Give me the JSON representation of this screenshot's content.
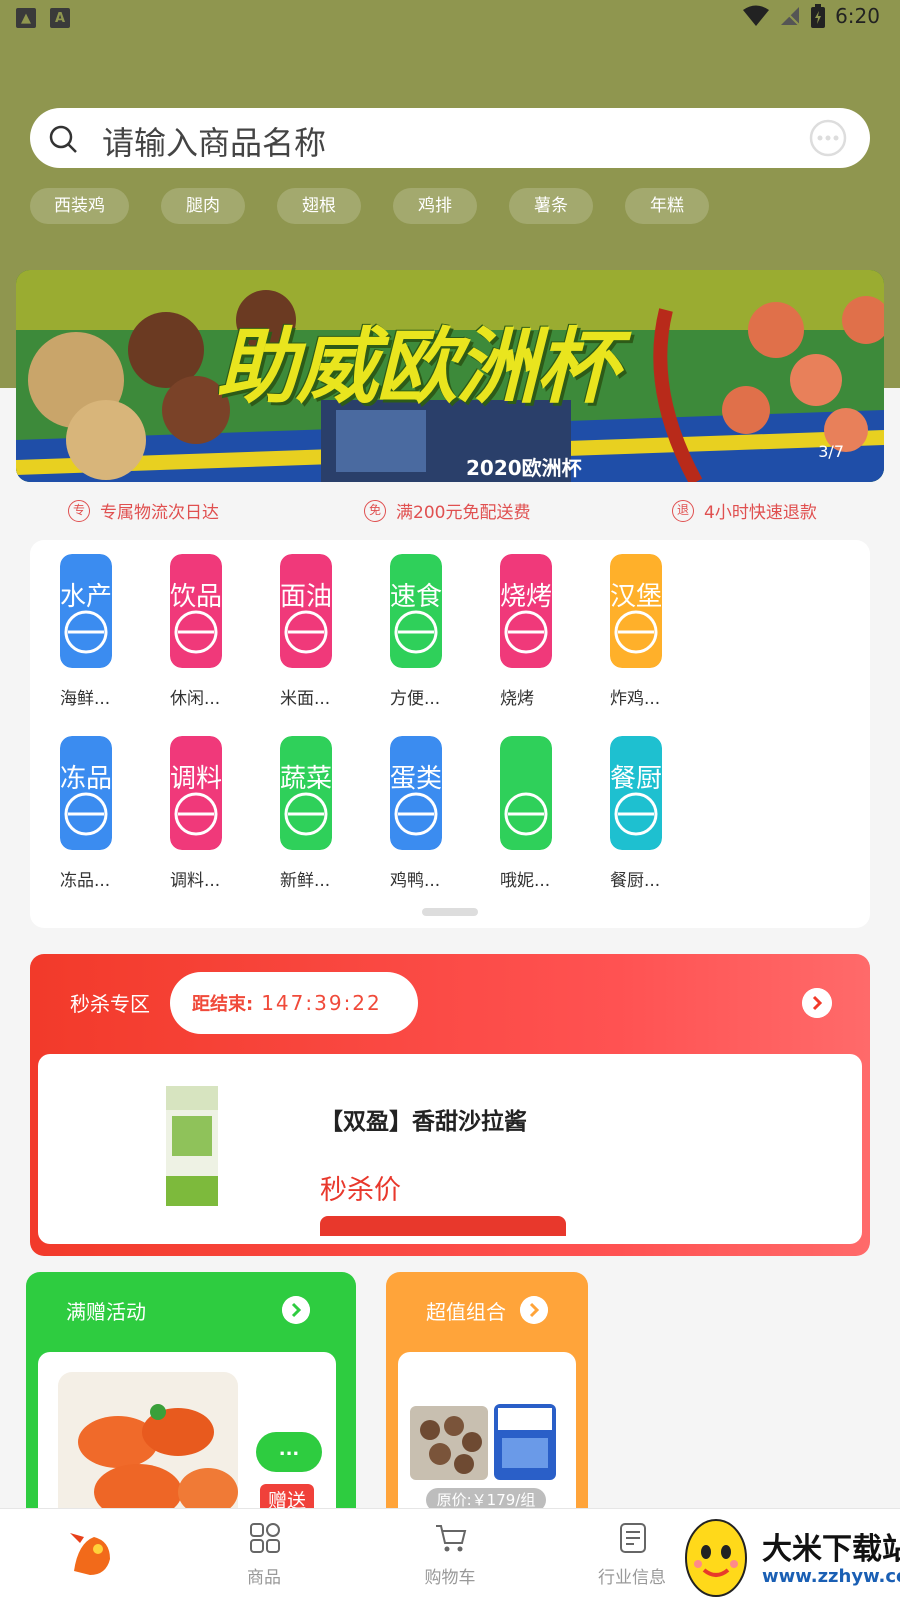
{
  "status_bar": {
    "time": "6:20"
  },
  "search": {
    "placeholder": "请输入商品名称"
  },
  "hot_words": [
    "西装鸡",
    "腿肉",
    "翅根",
    "鸡排",
    "薯条",
    "年糕"
  ],
  "banner": {
    "title": "助威欧洲杯",
    "subtitle": "2020欧洲杯",
    "indicator": "3/7"
  },
  "features": [
    {
      "icon": "专",
      "label": "专属物流次日达"
    },
    {
      "icon": "免",
      "label": "满200元免配送费"
    },
    {
      "icon": "退",
      "label": "4小时快速退款"
    }
  ],
  "categories": [
    {
      "badge": "水产",
      "label": "海鲜...",
      "color": "#3b8cf0",
      "icon": "shrimp-icon"
    },
    {
      "badge": "饮品",
      "label": "休闲...",
      "color": "#f0397a",
      "icon": "drink-icon"
    },
    {
      "badge": "面油",
      "label": "米面...",
      "color": "#f0397a",
      "icon": "rice-bowl-icon"
    },
    {
      "badge": "速食",
      "label": "方便...",
      "color": "#2fd05a",
      "icon": "noodle-bowl-icon"
    },
    {
      "badge": "烧烤",
      "label": "烧烤",
      "color": "#f0397a",
      "icon": "grill-icon"
    },
    {
      "badge": "汉堡",
      "label": "炸鸡...",
      "color": "#ffb02a",
      "icon": "burger-icon"
    },
    {
      "badge": "冻品",
      "label": "冻品...",
      "color": "#3b8cf0",
      "icon": "drumstick-icon"
    },
    {
      "badge": "调料",
      "label": "调料...",
      "color": "#f0397a",
      "icon": "bottles-icon"
    },
    {
      "badge": "蔬菜",
      "label": "新鲜...",
      "color": "#2fd05a",
      "icon": "broccoli-icon"
    },
    {
      "badge": "蛋类",
      "label": "鸡鸭...",
      "color": "#3b8cf0",
      "icon": "egg-icon"
    },
    {
      "badge": "",
      "label": "哦妮...",
      "color": "#2fd05a",
      "icon": "food-icon"
    },
    {
      "badge": "餐厨",
      "label": "餐厨...",
      "color": "#1ec0d0",
      "icon": "cutlery-icon"
    }
  ],
  "flash_sale": {
    "title": "秒杀专区",
    "countdown_label": "距结束:",
    "countdown_value": "147:39:22",
    "product_name": "【双盈】香甜沙拉酱",
    "price_label": "秒杀价"
  },
  "promo_full_gift": {
    "title": "满赠活动",
    "pill": "...",
    "tag": "赠送"
  },
  "promo_combo": {
    "title": "超值组合",
    "original_price": "原价:￥179/组"
  },
  "tabs": [
    {
      "label": "",
      "icon": "mascot-logo"
    },
    {
      "label": "商品",
      "icon": "grid-icon"
    },
    {
      "label": "购物车",
      "icon": "cart-icon"
    },
    {
      "label": "行业信息",
      "icon": "document-icon"
    }
  ],
  "watermark": {
    "text": "大米下载站",
    "url": "www.zzhyw.com"
  },
  "colors": {
    "header": "#8f964f",
    "flash": "#f23a2a",
    "green": "#2ecc40",
    "orange": "#ffa43a"
  }
}
